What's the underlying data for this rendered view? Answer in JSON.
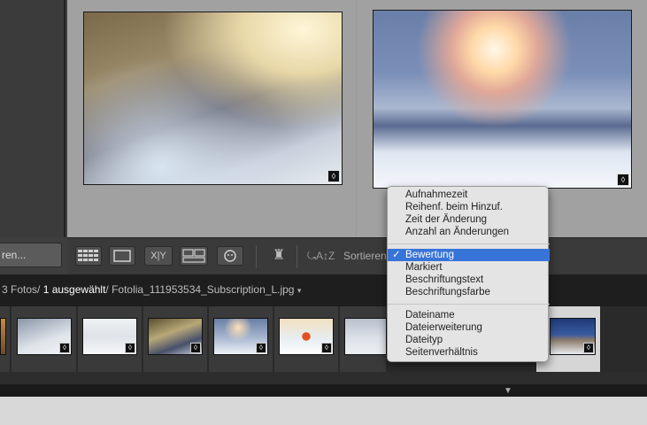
{
  "left_panel": {
    "import_label": "ren..."
  },
  "grid": {
    "photos": [
      {
        "badge_icon": "tag-icon"
      },
      {
        "badge_icon": "tag-icon"
      }
    ]
  },
  "toolbar": {
    "sort_label": "Sortieren"
  },
  "filmstrip_header": {
    "count": "3 Fotos/",
    "selected": "1 ausgewählt",
    "filename": "/ Fotolia_111953534_Subscription_L.jpg",
    "caret": "▾"
  },
  "sort_menu": {
    "groups": [
      [
        "Aufnahmezeit",
        "Reihenf. beim Hinzuf.",
        "Zeit der Änderung",
        "Anzahl an Änderungen"
      ],
      [
        "Bewertung",
        "Markiert",
        "Beschriftungstext",
        "Beschriftungsfarbe"
      ],
      [
        "Dateiname",
        "Dateierweiterung",
        "Dateityp",
        "Seitenverhältnis"
      ]
    ],
    "checked": "Bewertung",
    "check_mark": "✓"
  },
  "colors": {
    "menu_highlight": "#3874d7",
    "selected_thumb_bg": "#d6d6d6"
  }
}
